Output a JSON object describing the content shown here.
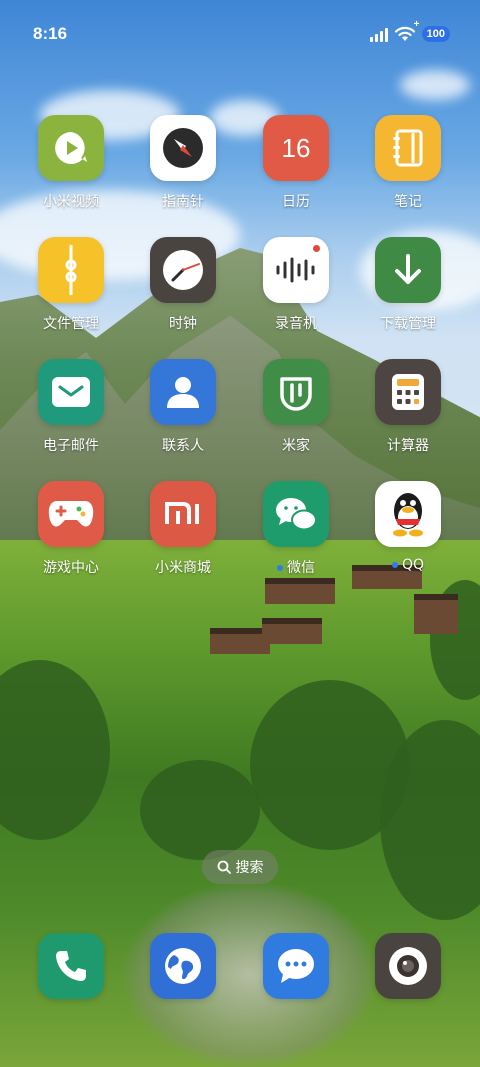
{
  "status_bar": {
    "time": "8:16",
    "battery_level": "100",
    "battery_charging_symbol": "+",
    "colors": {
      "battery_badge": "#2d6fe8"
    },
    "icons": [
      "signal-icon",
      "wifi-icon",
      "battery-icon"
    ]
  },
  "apps": [
    {
      "label": "小米视频",
      "icon": "video-play-icon",
      "color": "#8bb43e"
    },
    {
      "label": "指南针",
      "icon": "compass-icon",
      "color": "#ffffff"
    },
    {
      "label": "日历",
      "icon": "calendar-icon",
      "color": "#e05a45",
      "day": "16"
    },
    {
      "label": "笔记",
      "icon": "notes-icon",
      "color": "#f5b731"
    },
    {
      "label": "文件管理",
      "icon": "folder-icon",
      "color": "#f6c22a"
    },
    {
      "label": "时钟",
      "icon": "clock-icon",
      "color": "#4a4440"
    },
    {
      "label": "录音机",
      "icon": "recorder-icon",
      "color": "#ffffff"
    },
    {
      "label": "下载管理",
      "icon": "download-icon",
      "color": "#3f8a45"
    },
    {
      "label": "电子邮件",
      "icon": "mail-icon",
      "color": "#1f9a7c"
    },
    {
      "label": "联系人",
      "icon": "contacts-icon",
      "color": "#3477d9"
    },
    {
      "label": "米家",
      "icon": "mijia-icon",
      "color": "#3f8d46"
    },
    {
      "label": "计算器",
      "icon": "calculator-icon",
      "color": "#4c4541"
    },
    {
      "label": "游戏中心",
      "icon": "gamepad-icon",
      "color": "#e05a48"
    },
    {
      "label": "小米商城",
      "icon": "mi-store-icon",
      "color": "#dc5a45"
    },
    {
      "label": "微信",
      "icon": "wechat-icon",
      "color": "#1f9c6c",
      "notification_dot": true
    },
    {
      "label": "QQ",
      "icon": "qq-icon",
      "color": "#ffffff",
      "notification_dot": true
    }
  ],
  "search": {
    "label": "搜索",
    "icon": "search-icon"
  },
  "dock": [
    {
      "name": "phone",
      "icon": "phone-icon",
      "color": "#1f9a6e"
    },
    {
      "name": "browser",
      "icon": "globe-icon",
      "color": "#2f6fd6"
    },
    {
      "name": "messages",
      "icon": "message-icon",
      "color": "#2f7be0"
    },
    {
      "name": "camera",
      "icon": "camera-icon",
      "color": "#4a4440"
    }
  ]
}
